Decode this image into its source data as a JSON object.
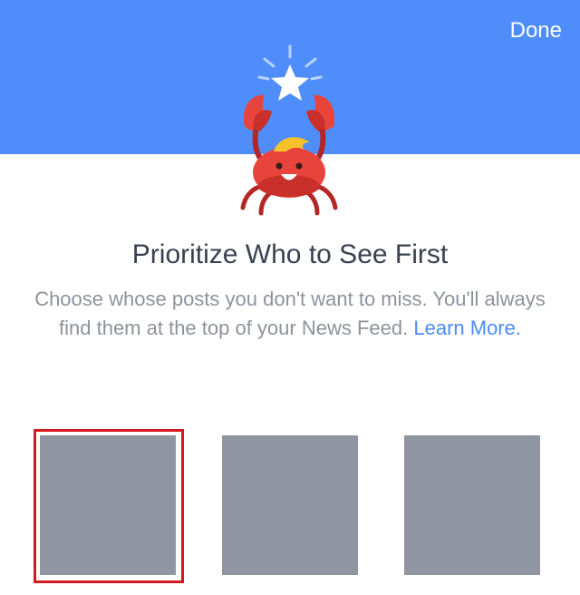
{
  "header": {
    "done_label": "Done",
    "bg_color": "#4f8dfb"
  },
  "mascot": {
    "icon": "crab-with-star-icon"
  },
  "content": {
    "title": "Prioritize Who to See First",
    "description": "Choose whose posts you don't want to miss. You'll always find them at the top of your News Feed.",
    "learn_more_label": "Learn More."
  },
  "tiles": [
    {
      "selected": true
    },
    {
      "selected": false
    },
    {
      "selected": false
    }
  ],
  "colors": {
    "tile": "#9096a1",
    "selection": "#d7191f",
    "link": "#4a8cf6"
  }
}
